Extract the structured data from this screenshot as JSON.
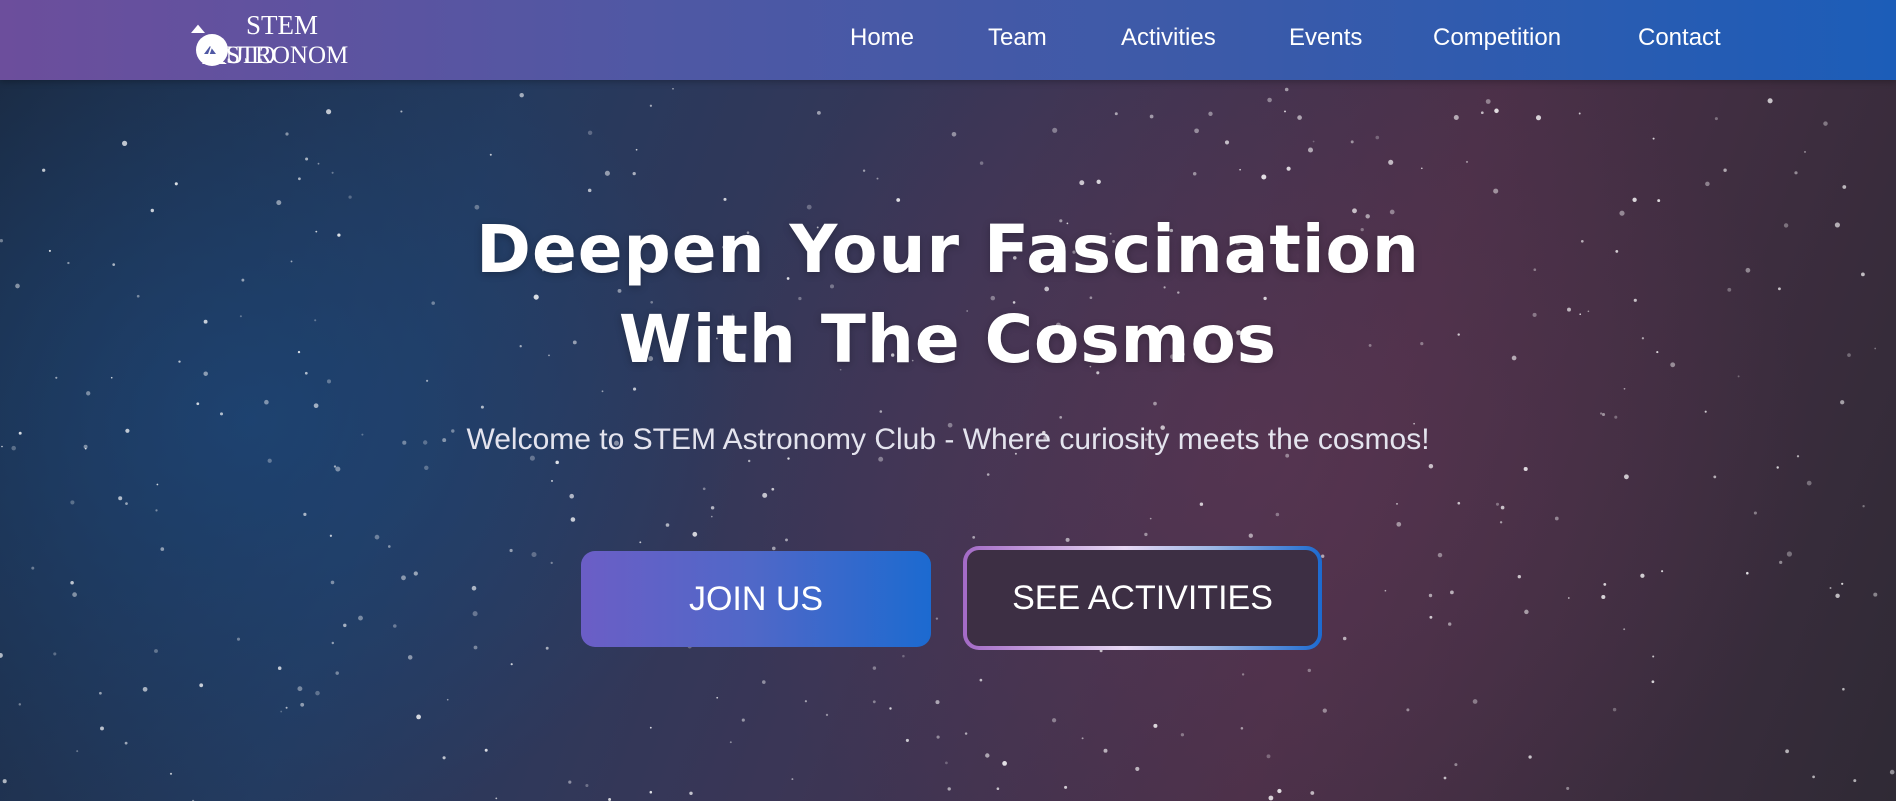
{
  "logo": {
    "line1": "STEM",
    "line2_left": "CLUB",
    "line2_right": "STRONOMY",
    "letter": "A"
  },
  "nav": {
    "items": [
      {
        "label": "Home"
      },
      {
        "label": "Team"
      },
      {
        "label": "Activities"
      },
      {
        "label": "Events"
      },
      {
        "label": "Competition"
      },
      {
        "label": "Contact"
      }
    ]
  },
  "hero": {
    "headline_line1": "Deepen Your Fascination",
    "headline_line2": "With The Cosmos",
    "subtitle": "Welcome to STEM Astronomy Club - Where curiosity meets the cosmos!",
    "primary_button": "JOIN US",
    "secondary_button": "SEE ACTIVITIES"
  },
  "colors": {
    "navbar_start": "#6c4e9c",
    "navbar_end": "#1c5db8",
    "button_start": "#6b5ec6",
    "button_end": "#1c6ad0",
    "text": "#ffffff"
  }
}
